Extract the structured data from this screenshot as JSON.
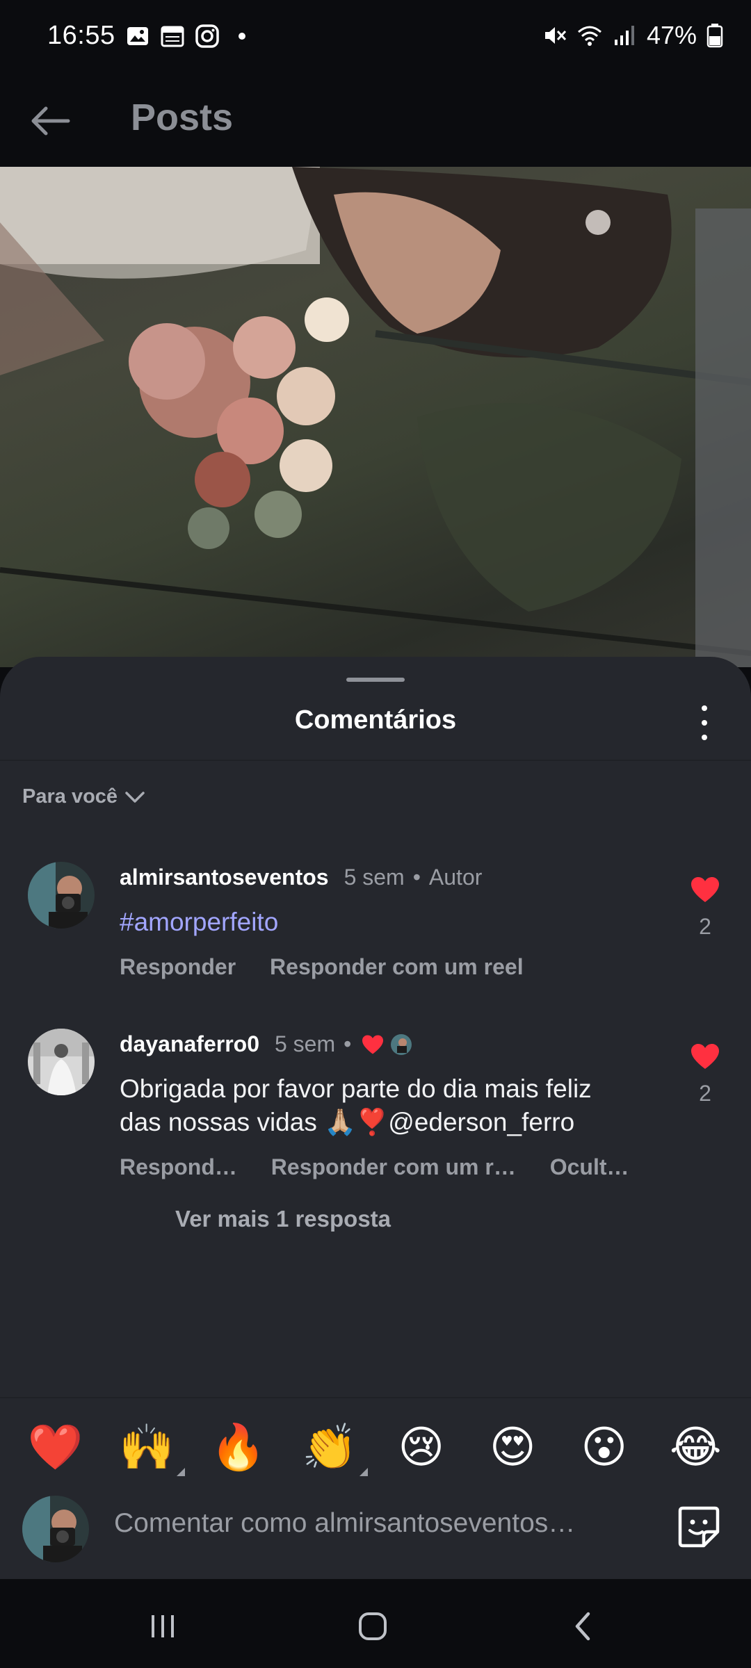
{
  "status_bar": {
    "time": "16:55",
    "battery": "47%",
    "left_icons": [
      "gallery-icon",
      "calendar-icon",
      "instagram-icon",
      "dot-icon"
    ],
    "right_icons": [
      "mute-icon",
      "wifi-icon",
      "signal-icon",
      "battery-icon"
    ]
  },
  "header": {
    "title": "Posts"
  },
  "sheet": {
    "title": "Comentários",
    "filter_label": "Para você"
  },
  "comments": [
    {
      "username": "almirsantoseventos",
      "age": "5 sem",
      "separator": "•",
      "badge": "Autor",
      "text": "#amorperfeito",
      "actions": [
        "Responder",
        "Responder com um reel"
      ],
      "likes": "2"
    },
    {
      "username": "dayanaferro0",
      "age": "5 sem",
      "separator": "•",
      "text": "Obrigada por favor parte do dia mais feliz das nossas vidas 🙏🏼❣️@ederson_ferro",
      "actions": [
        "Respond…",
        "Responder com um r…",
        "Ocult…"
      ],
      "likes": "2",
      "more_replies": "Ver mais 1 resposta"
    }
  ],
  "emoji_bar": [
    "❤️",
    "🙌",
    "🔥",
    "👏",
    "😢",
    "😍",
    "😮",
    "😂"
  ],
  "compose": {
    "placeholder": "Comentar como almirsantoseventos…"
  },
  "colors": {
    "sheet_bg": "#25272d",
    "like_red": "#ff3040",
    "hashtag": "#a2a6ff",
    "muted_text": "#9a9da4"
  }
}
